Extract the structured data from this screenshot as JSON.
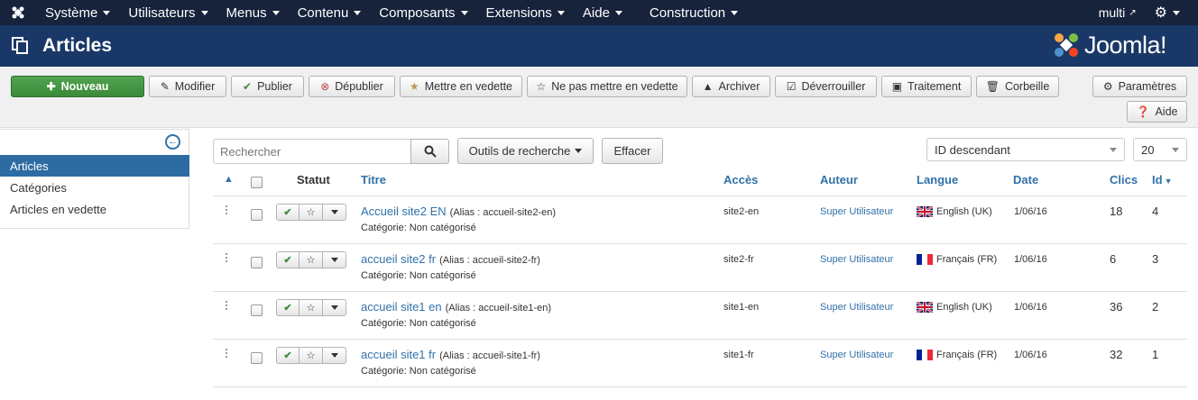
{
  "topnav": {
    "menus": [
      "Système",
      "Utilisateurs",
      "Menus",
      "Contenu",
      "Composants",
      "Extensions",
      "Aide",
      "Construction"
    ],
    "site_label": "multi"
  },
  "header": {
    "title": "Articles",
    "brand": "Joomla!"
  },
  "toolbar": {
    "new": "Nouveau",
    "edit": "Modifier",
    "publish": "Publier",
    "unpublish": "Dépublier",
    "feature": "Mettre en vedette",
    "unfeature": "Ne pas mettre en vedette",
    "archive": "Archiver",
    "checkin": "Déverrouiller",
    "batch": "Traitement",
    "trash": "Corbeille",
    "options": "Paramètres",
    "help": "Aide"
  },
  "sidebar": {
    "items": [
      {
        "label": "Articles",
        "active": true
      },
      {
        "label": "Catégories",
        "active": false
      },
      {
        "label": "Articles en vedette",
        "active": false
      }
    ]
  },
  "filters": {
    "search_placeholder": "Rechercher",
    "search_tools": "Outils de recherche",
    "clear": "Effacer",
    "ordering": "ID descendant",
    "limit": "20"
  },
  "table": {
    "headers": {
      "status": "Statut",
      "title": "Titre",
      "access": "Accès",
      "author": "Auteur",
      "language": "Langue",
      "date": "Date",
      "hits": "Clics",
      "id": "Id"
    },
    "rows": [
      {
        "title": "Accueil site2 EN",
        "alias": "(Alias : accueil-site2-en)",
        "category": "Catégorie: Non catégorisé",
        "access": "site2-en",
        "author": "Super Utilisateur",
        "language": "English (UK)",
        "flag": "uk",
        "date": "1/06/16",
        "hits": "18",
        "id": "4"
      },
      {
        "title": "accueil site2 fr",
        "alias": "(Alias : accueil-site2-fr)",
        "category": "Catégorie: Non catégorisé",
        "access": "site2-fr",
        "author": "Super Utilisateur",
        "language": "Français (FR)",
        "flag": "fr",
        "date": "1/06/16",
        "hits": "6",
        "id": "3"
      },
      {
        "title": "accueil site1 en",
        "alias": "(Alias : accueil-site1-en)",
        "category": "Catégorie: Non catégorisé",
        "access": "site1-en",
        "author": "Super Utilisateur",
        "language": "English (UK)",
        "flag": "uk",
        "date": "1/06/16",
        "hits": "36",
        "id": "2"
      },
      {
        "title": "accueil site1 fr",
        "alias": "(Alias : accueil-site1-fr)",
        "category": "Catégorie: Non catégorisé",
        "access": "site1-fr",
        "author": "Super Utilisateur",
        "language": "Français (FR)",
        "flag": "fr",
        "date": "1/06/16",
        "hits": "32",
        "id": "1"
      }
    ]
  },
  "colors": {
    "topnav": "#17223b",
    "header": "#1a3867",
    "link": "#3071a9",
    "success": "#46a546",
    "sidebar_active": "#2d6ca2"
  }
}
